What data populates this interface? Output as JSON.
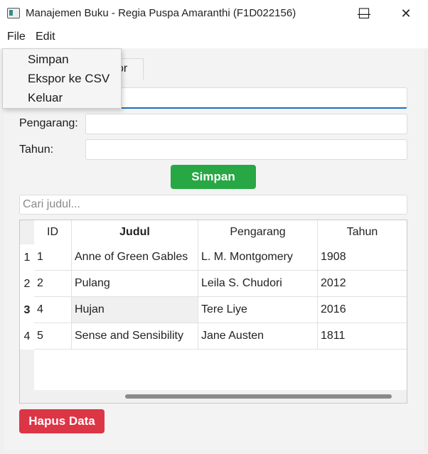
{
  "window": {
    "title": "Manajemen Buku - Regia Puspa Amaranthi (F1D022156)",
    "minimize": "—",
    "maximize": "☐",
    "close": "✕"
  },
  "menubar": {
    "file": "File",
    "edit": "Edit"
  },
  "file_menu": {
    "items": [
      "Simpan",
      "Ekspor ke CSV",
      "Keluar"
    ]
  },
  "tab": {
    "partial_label": "or"
  },
  "form": {
    "judul_value": "",
    "pengarang_label": "Pengarang:",
    "pengarang_value": "",
    "tahun_label": "Tahun:",
    "tahun_value": "",
    "save_button": "Simpan"
  },
  "search": {
    "placeholder": "Cari judul..."
  },
  "table": {
    "headers": [
      "ID",
      "Judul",
      "Pengarang",
      "Tahun"
    ],
    "row_numbers": [
      "1",
      "2",
      "3",
      "4"
    ],
    "rows": [
      [
        "1",
        "Anne of Green Gables",
        "L. M. Montgomery",
        "1908"
      ],
      [
        "2",
        "Pulang",
        "Leila S. Chudori",
        "2012"
      ],
      [
        "4",
        "Hujan",
        "Tere Liye",
        "2016"
      ],
      [
        "5",
        "Sense and Sensibility",
        "Jane Austen",
        "1811"
      ]
    ]
  },
  "delete_button": "Hapus Data",
  "colors": {
    "save": "#28a745",
    "delete": "#dc3545",
    "focus": "#1e6fc0"
  }
}
